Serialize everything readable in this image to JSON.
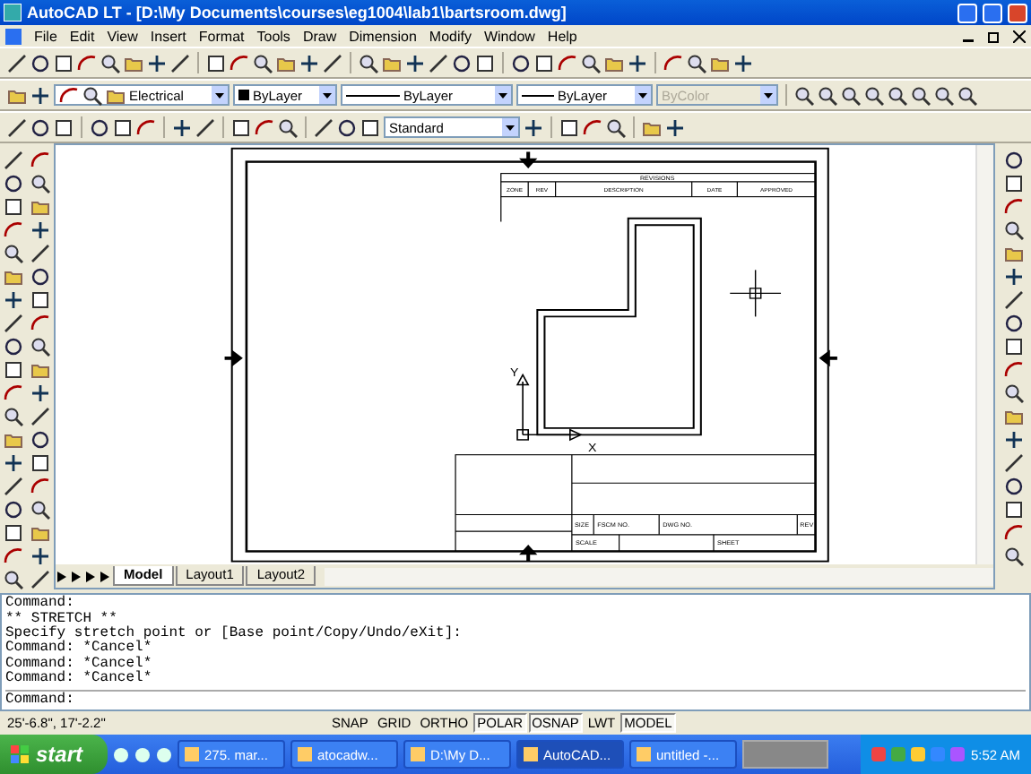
{
  "window": {
    "title": "AutoCAD LT - [D:\\My Documents\\courses\\eg1004\\lab1\\bartsroom.dwg]"
  },
  "menu": [
    "File",
    "Edit",
    "View",
    "Insert",
    "Format",
    "Tools",
    "Draw",
    "Dimension",
    "Modify",
    "Window",
    "Help"
  ],
  "properties_toolbar": {
    "layer": "Electrical",
    "color_setting": "ByLayer",
    "linetype": "ByLayer",
    "lineweight": "ByLayer",
    "plot_style": {
      "value": "ByColor",
      "disabled": true
    }
  },
  "dimension_style": "Standard",
  "drawing": {
    "revisions_block": {
      "title": "REVISIONS",
      "columns": [
        "ZONE",
        "REV",
        "DESCRIPTION",
        "DATE",
        "APPROVED"
      ]
    },
    "title_block": {
      "row_1": [
        "SIZE",
        "FSCM NO.",
        "DWG NO.",
        "REV"
      ],
      "row_2": [
        "SCALE",
        "SHEET"
      ]
    },
    "ucs": {
      "y_label": "Y",
      "x_label": "X"
    }
  },
  "layout_tabs": [
    {
      "label": "Model",
      "selected": true
    },
    {
      "label": "Layout1",
      "selected": false
    },
    {
      "label": "Layout2",
      "selected": false
    }
  ],
  "command_history": [
    "Command:",
    "** STRETCH **",
    "Specify stretch point or [Base point/Copy/Undo/eXit]:",
    "Command: *Cancel*",
    "Command: *Cancel*",
    "Command: *Cancel*"
  ],
  "command_prompt": "Command:",
  "status_bar": {
    "coordinates": "25'-6.8\", 17'-2.2\"",
    "buttons": [
      {
        "label": "SNAP",
        "on": false
      },
      {
        "label": "GRID",
        "on": false
      },
      {
        "label": "ORTHO",
        "on": false
      },
      {
        "label": "POLAR",
        "on": true
      },
      {
        "label": "OSNAP",
        "on": true
      },
      {
        "label": "LWT",
        "on": false
      },
      {
        "label": "MODEL",
        "on": true
      }
    ]
  },
  "taskbar": {
    "start": "start",
    "tasks": [
      {
        "label": "275. mar...",
        "selected": false
      },
      {
        "label": "atocadw...",
        "selected": false
      },
      {
        "label": "D:\\My D...",
        "selected": false
      },
      {
        "label": "AutoCAD...",
        "selected": true
      },
      {
        "label": "untitled -...",
        "selected": false
      }
    ],
    "clock": "5:52 AM"
  }
}
